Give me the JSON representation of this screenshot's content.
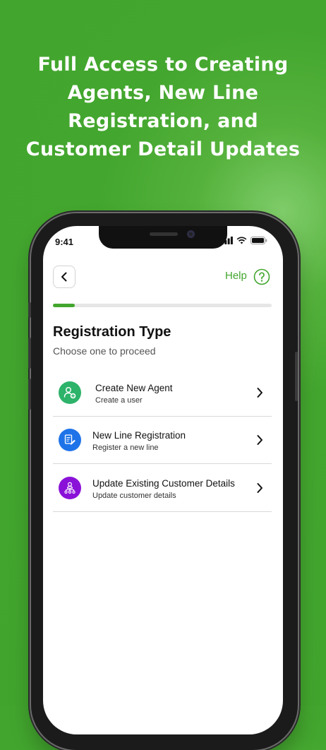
{
  "headline": {
    "lines": [
      "Full Access to Creating",
      "Agents, New Line",
      "Registration, and",
      "Customer Detail Updates"
    ]
  },
  "status_bar": {
    "time": "9:41"
  },
  "header": {
    "help_label": "Help"
  },
  "progress": {
    "fraction": 0.1
  },
  "page": {
    "title": "Registration Type",
    "subtitle": "Choose one to proceed"
  },
  "options": [
    {
      "title": "Create New Agent",
      "subtitle": "Create a user",
      "icon": "add-user-icon",
      "color": "#2db36a"
    },
    {
      "title": "New Line Registration",
      "subtitle": "Register a new line",
      "icon": "document-edit-icon",
      "color": "#1e73e8"
    },
    {
      "title": "Update Existing Customer Details",
      "subtitle": "Update customer details",
      "icon": "customer-network-icon",
      "color": "#8a12d8"
    }
  ],
  "colors": {
    "background": "#43a62e",
    "accent": "#43a62e"
  }
}
